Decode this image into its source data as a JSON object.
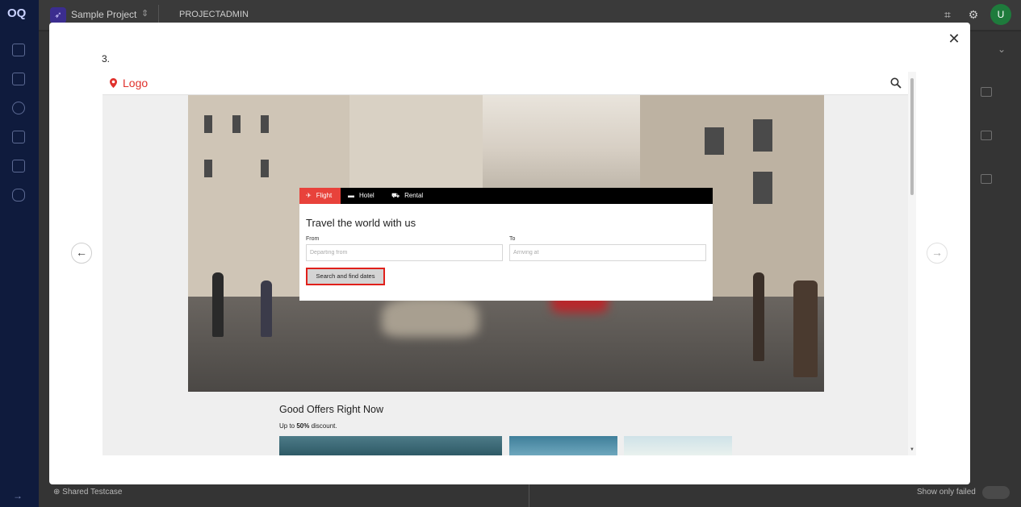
{
  "app": {
    "logo": "OQ",
    "project_name": "Sample Project",
    "role": "PROJECTADMIN",
    "user_initial": "U",
    "bottom_left_label": "Shared Testcase",
    "bottom_right_label": "Show only failed"
  },
  "modal": {
    "step_label": "3.",
    "close_symbol": "✕",
    "prev_symbol": "←",
    "next_symbol": "→"
  },
  "site": {
    "logo_text": "Logo",
    "tabs": [
      {
        "label": "Flight",
        "icon": "plane-icon",
        "active": true
      },
      {
        "label": "Hotel",
        "icon": "bed-icon",
        "active": false
      },
      {
        "label": "Rental",
        "icon": "car-icon",
        "active": false
      }
    ],
    "widget_title": "Travel the world with us",
    "from_label": "From",
    "from_placeholder": "Departing from",
    "to_label": "To",
    "to_placeholder": "Arriving at",
    "search_button": "Search and find dates",
    "offers_title": "Good Offers Right Now",
    "offers_sub_prefix": "Up to ",
    "offers_sub_bold": "50%",
    "offers_sub_suffix": " discount."
  },
  "colors": {
    "brand_red": "#e0312c",
    "active_tab": "#e8423b",
    "sidebar": "#0f1b3d",
    "avatar": "#1e7b3c"
  }
}
